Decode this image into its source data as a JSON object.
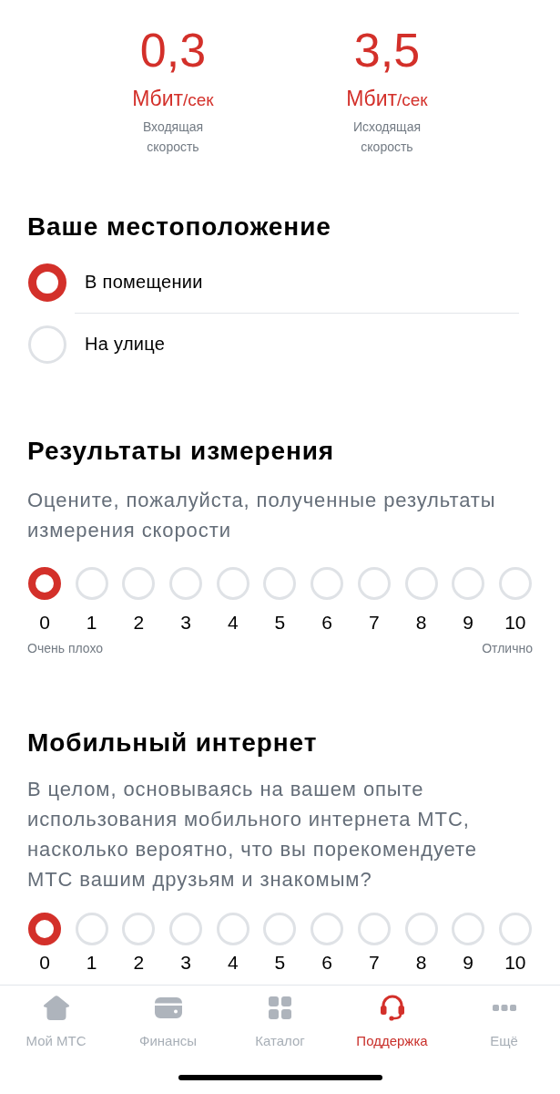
{
  "speeds": [
    {
      "value": "0,3",
      "unit": "Мбит",
      "per": "/сек",
      "label": "Входящая скорость"
    },
    {
      "value": "3,5",
      "unit": "Мбит",
      "per": "/сек",
      "label": "Исходящая скорость"
    }
  ],
  "location": {
    "title": "Ваше местоположение",
    "options": [
      {
        "label": "В помещении",
        "selected": true
      },
      {
        "label": "На улице",
        "selected": false
      }
    ]
  },
  "results": {
    "title": "Результаты измерения",
    "description": "Оцените, пожалуйста, полученные результаты измерения скорости",
    "scale": [
      {
        "label": "0",
        "selected": true
      },
      {
        "label": "1",
        "selected": false
      },
      {
        "label": "2",
        "selected": false
      },
      {
        "label": "3",
        "selected": false
      },
      {
        "label": "4",
        "selected": false
      },
      {
        "label": "5",
        "selected": false
      },
      {
        "label": "6",
        "selected": false
      },
      {
        "label": "7",
        "selected": false
      },
      {
        "label": "8",
        "selected": false
      },
      {
        "label": "9",
        "selected": false
      },
      {
        "label": "10",
        "selected": false
      }
    ],
    "low_label": "Очень плохо",
    "high_label": "Отлично"
  },
  "mobile_internet": {
    "title": "Мобильный интернет",
    "description": "В целом, основываясь на вашем опыте использования мобильного интернета МТС, насколько вероятно, что вы порекомендуете МТС вашим друзьям и знакомым?",
    "scale": [
      {
        "label": "0",
        "selected": true
      },
      {
        "label": "1",
        "selected": false
      },
      {
        "label": "2",
        "selected": false
      },
      {
        "label": "3",
        "selected": false
      },
      {
        "label": "4",
        "selected": false
      },
      {
        "label": "5",
        "selected": false
      },
      {
        "label": "6",
        "selected": false
      },
      {
        "label": "7",
        "selected": false
      },
      {
        "label": "8",
        "selected": false
      },
      {
        "label": "9",
        "selected": false
      },
      {
        "label": "10",
        "selected": false
      }
    ]
  },
  "tab_bar": [
    {
      "label": "Мой МТС",
      "kind": "home",
      "selected": false
    },
    {
      "label": "Финансы",
      "kind": "wallet",
      "selected": false
    },
    {
      "label": "Каталог",
      "kind": "grid",
      "selected": false
    },
    {
      "label": "Поддержка",
      "kind": "headset",
      "selected": true
    },
    {
      "label": "Ещё",
      "kind": "more",
      "selected": false
    }
  ]
}
